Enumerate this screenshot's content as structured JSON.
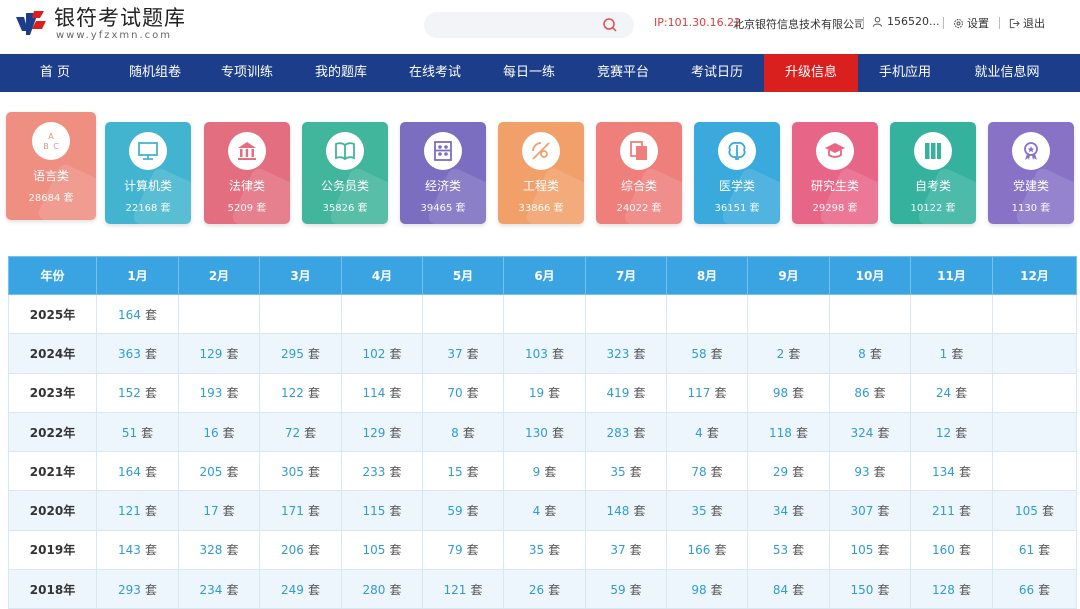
{
  "header": {
    "logo_title": "银符考试题库",
    "logo_url": "www.yfzxmn.com",
    "ip": "IP:101.30.16.22",
    "company": "北京银符信息技术有限公司",
    "user": "156520...",
    "settings": "设置",
    "logout": "退出"
  },
  "nav": [
    "首 页",
    "随机组卷",
    "专项训练",
    "我的题库",
    "在线考试",
    "每日一练",
    "竞赛平台",
    "考试日历",
    "升级信息",
    "手机应用",
    "就业信息网"
  ],
  "nav_active": "升级信息",
  "categories": [
    {
      "name": "语言类",
      "count": "28684 套",
      "color": "#ee8f82",
      "icon": "abc-blocks-icon"
    },
    {
      "name": "计算机类",
      "count": "22168 套",
      "color": "#43b4cf",
      "icon": "monitor-icon"
    },
    {
      "name": "法律类",
      "count": "5209 套",
      "color": "#e36e7f",
      "icon": "courthouse-icon"
    },
    {
      "name": "公务员类",
      "count": "35826 套",
      "color": "#42b59d",
      "icon": "book-icon"
    },
    {
      "name": "经济类",
      "count": "39465 套",
      "color": "#7b6ec0",
      "icon": "abacus-icon"
    },
    {
      "name": "工程类",
      "count": "33866 套",
      "color": "#f2a06a",
      "icon": "ruler-icon"
    },
    {
      "name": "综合类",
      "count": "24022 套",
      "color": "#ee7f7b",
      "icon": "documents-icon"
    },
    {
      "name": "医学类",
      "count": "36151 套",
      "color": "#3aa9dc",
      "icon": "brain-icon"
    },
    {
      "name": "研究生类",
      "count": "29298 套",
      "color": "#e76688",
      "icon": "graduation-cap-icon"
    },
    {
      "name": "自考类",
      "count": "10122 套",
      "color": "#34b29e",
      "icon": "books-icon"
    },
    {
      "name": "党建类",
      "count": "1130 套",
      "color": "#8772c6",
      "icon": "medal-icon"
    }
  ],
  "table": {
    "headers": [
      "年份",
      "1月",
      "2月",
      "3月",
      "4月",
      "5月",
      "6月",
      "7月",
      "8月",
      "9月",
      "10月",
      "11月",
      "12月"
    ],
    "unit": "套",
    "rows": [
      {
        "year": "2025年",
        "values": [
          "164",
          "",
          "",
          "",
          "",
          "",
          "",
          "",
          "",
          "",
          "",
          ""
        ]
      },
      {
        "year": "2024年",
        "values": [
          "363",
          "129",
          "295",
          "102",
          "37",
          "103",
          "323",
          "58",
          "2",
          "8",
          "1",
          ""
        ]
      },
      {
        "year": "2023年",
        "values": [
          "152",
          "193",
          "122",
          "114",
          "70",
          "19",
          "419",
          "117",
          "98",
          "86",
          "24",
          ""
        ]
      },
      {
        "year": "2022年",
        "values": [
          "51",
          "16",
          "72",
          "129",
          "8",
          "130",
          "283",
          "4",
          "118",
          "324",
          "12",
          ""
        ]
      },
      {
        "year": "2021年",
        "values": [
          "164",
          "205",
          "305",
          "233",
          "15",
          "9",
          "35",
          "78",
          "29",
          "93",
          "134",
          ""
        ]
      },
      {
        "year": "2020年",
        "values": [
          "121",
          "17",
          "171",
          "115",
          "59",
          "4",
          "148",
          "35",
          "34",
          "307",
          "211",
          "105"
        ]
      },
      {
        "year": "2019年",
        "values": [
          "143",
          "328",
          "206",
          "105",
          "79",
          "35",
          "37",
          "166",
          "53",
          "105",
          "160",
          "61"
        ]
      },
      {
        "year": "2018年",
        "values": [
          "293",
          "234",
          "249",
          "280",
          "121",
          "26",
          "59",
          "98",
          "84",
          "150",
          "128",
          "66"
        ]
      }
    ]
  }
}
